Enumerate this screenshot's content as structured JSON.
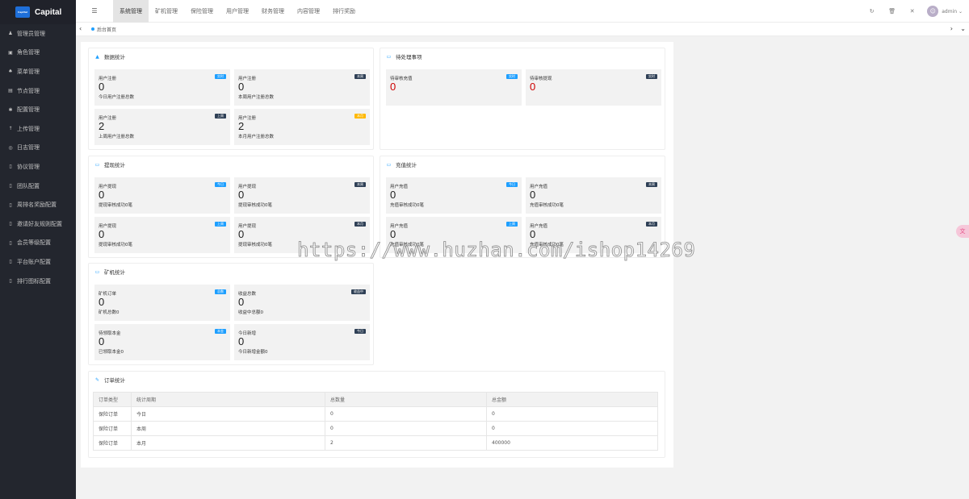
{
  "app": {
    "logo_text": "Capital",
    "logo_mark": "Capital"
  },
  "sidebar": {
    "items": [
      {
        "label": "管理员管理",
        "icon": "user-icon",
        "glyph": "♟"
      },
      {
        "label": "角色管理",
        "icon": "role-icon",
        "glyph": "▣"
      },
      {
        "label": "菜单管理",
        "icon": "bell-icon",
        "glyph": "♠"
      },
      {
        "label": "节点管理",
        "icon": "node-icon",
        "glyph": "▤"
      },
      {
        "label": "配置管理",
        "icon": "gear-icon",
        "glyph": "✱"
      },
      {
        "label": "上传管理",
        "icon": "upload-icon",
        "glyph": "↑"
      },
      {
        "label": "日志管理",
        "icon": "log-icon",
        "glyph": "◎"
      },
      {
        "label": "协议管理",
        "icon": "doc-icon",
        "glyph": "▯"
      },
      {
        "label": "团队配置",
        "icon": "team-icon",
        "glyph": "▯"
      },
      {
        "label": "周排名奖励配置",
        "icon": "rank-icon",
        "glyph": "▯"
      },
      {
        "label": "邀请好友规则配置",
        "icon": "invite-icon",
        "glyph": "▯"
      },
      {
        "label": "会员等级配置",
        "icon": "level-icon",
        "glyph": "▯"
      },
      {
        "label": "平台账户配置",
        "icon": "account-icon",
        "glyph": "▯"
      },
      {
        "label": "排行图标配置",
        "icon": "rank-image-icon",
        "glyph": "▯"
      }
    ]
  },
  "topnav": {
    "toggle_glyph": "☰",
    "items": [
      "系统管理",
      "矿机管理",
      "保险管理",
      "用户管理",
      "财务管理",
      "内容管理",
      "排行奖励"
    ],
    "active": 0,
    "user": "admin",
    "tools": [
      {
        "name": "refresh-icon",
        "glyph": "↻"
      },
      {
        "name": "trash-icon",
        "glyph": "🗑"
      },
      {
        "name": "fullscreen-icon",
        "glyph": "✕"
      }
    ],
    "user_caret": "⌄"
  },
  "tabs": {
    "home": "后台首页",
    "prev_glyph": "‹",
    "next_glyph": "›",
    "more_glyph": "⌄"
  },
  "panels": [
    {
      "key": "data",
      "title": "数据统计",
      "icon": "warning-icon",
      "glyph": "▲",
      "cards": [
        {
          "label": "用户注册",
          "badge": "实时",
          "badge_color": "blue",
          "value": "0",
          "sub": "今日用户注册总数"
        },
        {
          "label": "用户注册",
          "badge": "本周",
          "badge_color": "dark",
          "value": "0",
          "sub": "本周用户注册总数"
        },
        {
          "label": "用户注册",
          "badge": "上周",
          "badge_color": "dark",
          "value": "2",
          "sub": "上周用户注册总数"
        },
        {
          "label": "用户注册",
          "badge": "本月",
          "badge_color": "yellow",
          "value": "2",
          "sub": "本月用户注册总数"
        }
      ]
    },
    {
      "key": "todo",
      "title": "待处理事项",
      "icon": "card-icon",
      "glyph": "▭",
      "cards": [
        {
          "label": "待审核充值",
          "badge": "实时",
          "badge_color": "blue",
          "value": "0",
          "sub": "",
          "red": true
        },
        {
          "label": "待审核提现",
          "badge": "实时",
          "badge_color": "dark",
          "value": "0",
          "sub": "",
          "red": true
        }
      ]
    },
    {
      "key": "withdraw",
      "title": "提现统计",
      "icon": "card-icon",
      "glyph": "▭",
      "cards": [
        {
          "label": "用户提现",
          "badge": "今日",
          "badge_color": "blue",
          "value": "0",
          "sub": "提现审核成功0笔"
        },
        {
          "label": "用户提现",
          "badge": "本周",
          "badge_color": "dark",
          "value": "0",
          "sub": "提现审核成功0笔"
        },
        {
          "label": "用户提现",
          "badge": "上周",
          "badge_color": "blue",
          "value": "0",
          "sub": "提现审核成功0笔"
        },
        {
          "label": "用户提现",
          "badge": "本月",
          "badge_color": "dark",
          "value": "0",
          "sub": "提现审核成功0笔"
        }
      ]
    },
    {
      "key": "recharge",
      "title": "充值统计",
      "icon": "card-icon",
      "glyph": "▭",
      "cards": [
        {
          "label": "用户充值",
          "badge": "今日",
          "badge_color": "blue",
          "value": "0",
          "sub": "充值审核成功0笔"
        },
        {
          "label": "用户充值",
          "badge": "本周",
          "badge_color": "dark",
          "value": "0",
          "sub": "充值审核成功0笔"
        },
        {
          "label": "用户充值",
          "badge": "上周",
          "badge_color": "blue",
          "value": "0",
          "sub": "充值审核成功0笔"
        },
        {
          "label": "用户充值",
          "badge": "本月",
          "badge_color": "dark",
          "value": "0",
          "sub": "充值审核成功0笔"
        }
      ]
    },
    {
      "key": "miner",
      "title": "矿机统计",
      "icon": "card-icon",
      "glyph": "▭",
      "cards": [
        {
          "label": "矿机订单",
          "badge": "总数",
          "badge_color": "blue",
          "value": "0",
          "sub": "矿机总数0"
        },
        {
          "label": "收益总数",
          "badge": "收益中",
          "badge_color": "dark",
          "value": "0",
          "sub": "收益中总额0"
        },
        {
          "label": "待领取本金",
          "badge": "本金",
          "badge_color": "blue",
          "value": "0",
          "sub": "已领取本金0"
        },
        {
          "label": "今日新增",
          "badge": "今日",
          "badge_color": "dark",
          "value": "0",
          "sub": "今日新增金额0"
        }
      ]
    },
    {
      "key": "order",
      "title": "订单统计",
      "icon": "edit-icon",
      "glyph": "✎",
      "cards": []
    }
  ],
  "order_table": {
    "headers": [
      "订单类型",
      "统计周期",
      "总数量",
      "总金额"
    ],
    "rows": [
      [
        "保险订单",
        "今日",
        "0",
        "0"
      ],
      [
        "保险订单",
        "本周",
        "0",
        "0"
      ],
      [
        "保险订单",
        "本月",
        "2",
        "400000"
      ]
    ]
  },
  "watermark": "https://www.huzhan.com/ishop14269",
  "side_bubble_glyph": "文"
}
